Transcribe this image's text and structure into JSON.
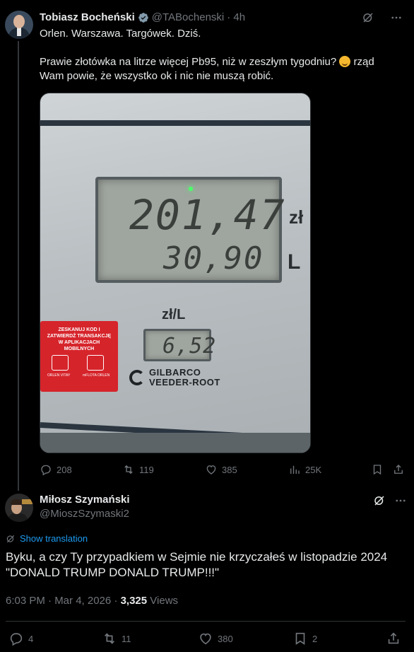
{
  "parent_tweet": {
    "author_name": "Tobiasz Bocheński",
    "handle": "@TABochenski",
    "time": "· 4h",
    "text_line1": "Orlen. Warszawa. Targówek. Dziś.",
    "text_line2_before_emoji": "Prawie złotówka na litrze więcej Pb95, niż w zeszłym tygodniu?",
    "text_line2_after_emoji": "rząd Wam powie, że wszystko ok i nic nie muszą robić.",
    "photo": {
      "display_price": "201,47",
      "display_volume": "30,90",
      "unit_pln": "zł",
      "unit_litre": "L",
      "unit_price_label": "zł/L",
      "unit_price": "6,52",
      "sign_text": "ZESKANUJ KOD I ZATWIERDŹ TRANSAKCJĘ W APLIKACJACH MOBILNYCH",
      "sign_caption_left": "ORLEN VITAY",
      "sign_caption_right": "mFLOTA ORLEN",
      "brand_line1": "GILBARCO",
      "brand_line2": "VEEDER-ROOT"
    },
    "stats": {
      "replies": "208",
      "reposts": "119",
      "likes": "385",
      "views": "25K"
    }
  },
  "reply_tweet": {
    "author_name": "Miłosz Szymański",
    "handle": "@MioszSzymaski2",
    "translate_label": "Show translation",
    "text": "Byku, a czy Ty przypadkiem w Sejmie nie krzyczałeś w listopadzie 2024 \"DONALD TRUMP DONALD TRUMP!!!\"",
    "timestamp": "6:03 PM · Mar 4, 2026 · ",
    "views_count": "3,325",
    "views_label": " Views",
    "stats": {
      "replies": "4",
      "reposts": "11",
      "likes": "380",
      "bookmarks": "2"
    }
  },
  "colors": {
    "background": "#000000",
    "text_primary": "#e7e9ea",
    "text_secondary": "#71767b",
    "link": "#1d9bf0",
    "verified": "#829aab",
    "divider": "#2f3336"
  }
}
